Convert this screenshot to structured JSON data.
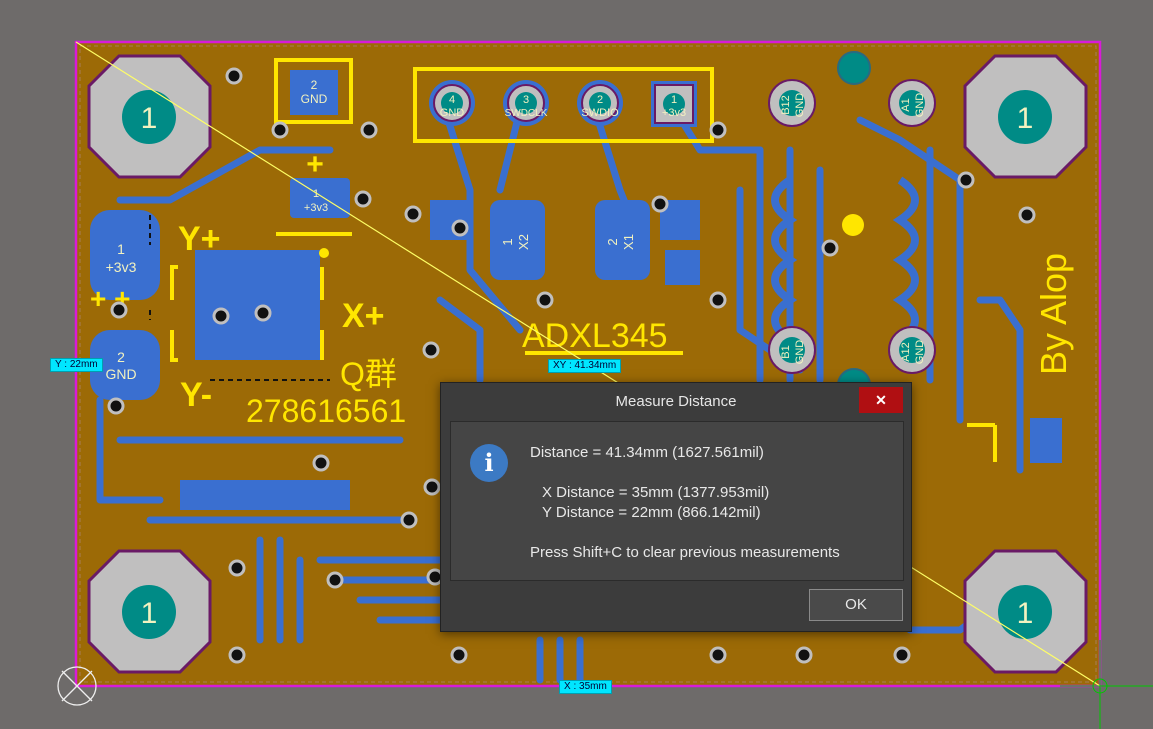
{
  "board": {
    "mount_hole_label": "1",
    "title_text": "ADXL345",
    "author_text": "By Alop",
    "group_label": "Q群",
    "group_number": "278616561",
    "axis_labels": {
      "y_plus": "Y+",
      "y_minus": "Y-",
      "x_plus": "X+",
      "plus_signs": "+ +",
      "plus_single": "+"
    },
    "header_pins": [
      {
        "num": "4",
        "name": "GND"
      },
      {
        "num": "3",
        "name": "SWDCLK"
      },
      {
        "num": "2",
        "name": "SWDIO"
      },
      {
        "num": "1",
        "name": "+3v3"
      }
    ],
    "pads": {
      "top_gnd": {
        "num": "2",
        "name": "GND"
      },
      "pwr_3v3": {
        "num": "1",
        "name": "+3v3"
      },
      "left_3v3": {
        "num": "1",
        "name": "+3v3"
      },
      "left_gnd": {
        "num": "2",
        "name": "GND"
      },
      "x2": {
        "num": "1",
        "name": "X2"
      },
      "x1": {
        "num": "2",
        "name": "X1"
      },
      "b12": {
        "num": "B12",
        "name": "GND"
      },
      "a1": {
        "num": "A1",
        "name": "GND"
      },
      "b1": {
        "num": "B1",
        "name": "GND"
      },
      "a12": {
        "num": "A12",
        "name": "GND"
      }
    },
    "colors": {
      "board": "#9c6a06",
      "copper": "#3a6fd0",
      "silk": "#ffe600",
      "pad_hole": "#008b86",
      "outline": "#d81bd8"
    }
  },
  "measure": {
    "y_label": "Y : 22mm",
    "xy_label": "XY : 41.34mm",
    "x_label": "X : 35mm"
  },
  "dialog": {
    "title": "Measure Distance",
    "close_glyph": "✕",
    "icon_glyph": "i",
    "distance_line": "Distance = 41.34mm (1627.561mil)",
    "x_line": "X Distance = 35mm (1377.953mil)",
    "y_line": "Y Distance = 22mm (866.142mil)",
    "hint": "Press Shift+C to clear previous measurements",
    "ok_label": "OK"
  }
}
